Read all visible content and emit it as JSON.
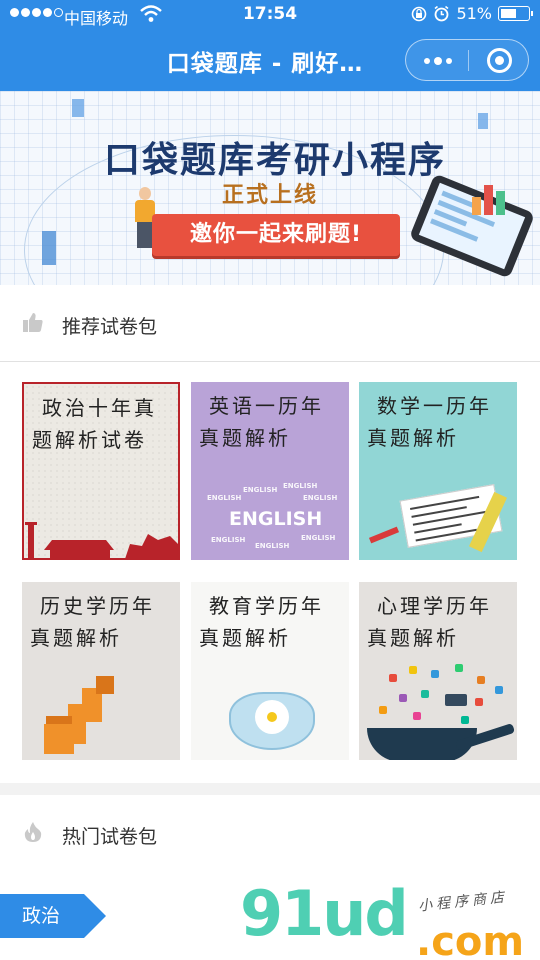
{
  "status_bar": {
    "carrier": "中国移动",
    "time": "17:54",
    "battery": "51%"
  },
  "nav": {
    "title": "口袋题库 - 刷好…"
  },
  "banner": {
    "title": "口袋题库考研小程序",
    "subtitle": "正式上线",
    "cta": "邀你一起来刷题!",
    "slide_count": 2,
    "active_slide": 1
  },
  "recommended": {
    "header": "推荐试卷包",
    "items": [
      {
        "title": "政治十年真题解析试卷"
      },
      {
        "title": "英语一历年真题解析",
        "art_text": "ENGLISH"
      },
      {
        "title": "数学一历年真题解析"
      },
      {
        "title": "历史学历年真题解析"
      },
      {
        "title": "教育学历年真题解析"
      },
      {
        "title": "心理学历年真题解析"
      }
    ]
  },
  "hot": {
    "header": "热门试卷包"
  },
  "tabs": {
    "active": "政治"
  },
  "watermark": {
    "main": "91ud",
    "tld": ".com",
    "script": "小程序商店"
  },
  "colors": {
    "brand_blue": "#2f8ce6",
    "cta_red": "#e8513f",
    "banner_title": "#1d3a6e"
  }
}
